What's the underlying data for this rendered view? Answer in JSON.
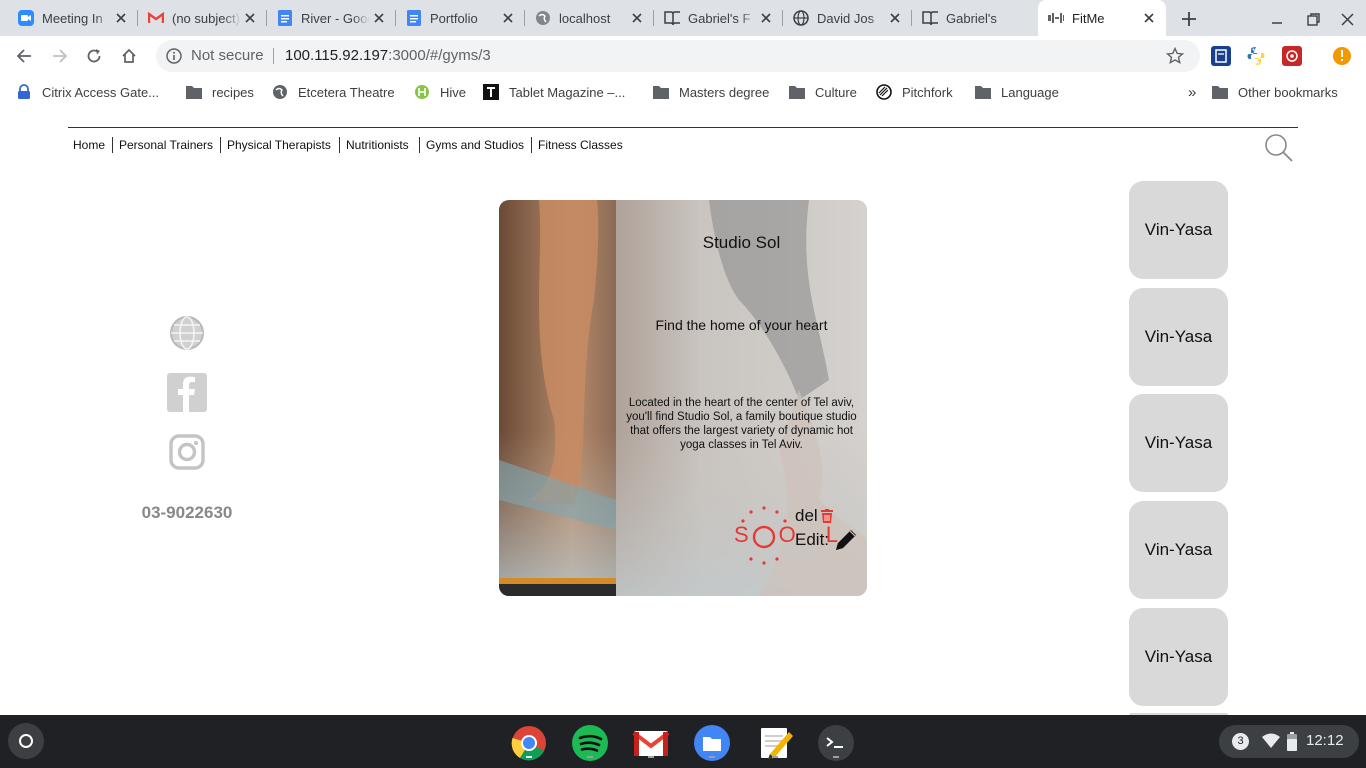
{
  "browser": {
    "tabs": [
      {
        "title": "Meeting In",
        "icon": "zoom-icon"
      },
      {
        "title": "(no subject)",
        "icon": "gmail-icon"
      },
      {
        "title": "River - Google Docs",
        "icon": "docs-icon"
      },
      {
        "title": "Portfolio",
        "icon": "docs-icon"
      },
      {
        "title": "localhost",
        "icon": "globe-icon"
      },
      {
        "title": "Gabriel's F",
        "icon": "book-icon"
      },
      {
        "title": "David Jos",
        "icon": "globe-icon"
      },
      {
        "title": "Gabriel's",
        "icon": "book-icon"
      },
      {
        "title": "FitMe",
        "icon": "fitme-icon",
        "active": true
      }
    ],
    "security_label": "Not secure",
    "url_host": "100.115.92.197",
    "url_rest": ":3000/#/gyms/3",
    "bookmarks": [
      {
        "label": "Citrix Access Gate...",
        "icon": "citrix-icon"
      },
      {
        "label": "recipes",
        "icon": "folder-icon"
      },
      {
        "label": "Etcetera Theatre",
        "icon": "globe-icon"
      },
      {
        "label": "Hive",
        "icon": "hive-icon"
      },
      {
        "label": "Tablet Magazine –...",
        "icon": "tablet-icon"
      },
      {
        "label": "Masters degree",
        "icon": "folder-icon"
      },
      {
        "label": "Culture",
        "icon": "folder-icon"
      },
      {
        "label": "Pitchfork",
        "icon": "pitchfork-icon"
      },
      {
        "label": "Language",
        "icon": "folder-icon"
      }
    ],
    "overflow": "»",
    "other_bookmarks": "Other bookmarks"
  },
  "site": {
    "nav": [
      "Home",
      "Personal Trainers",
      "Physical Therapists",
      "Nutritionists",
      "Gyms and Studios",
      "Fitness Classes"
    ],
    "phone": "03-9022630",
    "studio": {
      "name": "Studio Sol",
      "tagline": "Find the home of your heart",
      "description": "Located in the heart of the center of Tel aviv, you'll find Studio Sol, a family boutique studio that offers the largest variety of dynamic hot yoga classes in Tel Aviv.",
      "del_label": "del",
      "edit_label": "Edit:",
      "logo_text": "SOL"
    },
    "classes": [
      "Vin-Yasa",
      "Vin-Yasa",
      "Vin-Yasa",
      "Vin-Yasa",
      "Vin-Yasa"
    ]
  },
  "shelf": {
    "apps": [
      "chrome-icon",
      "spotify-icon",
      "gmail-icon",
      "files-icon",
      "text-editor-icon",
      "terminal-icon"
    ],
    "notification_count": "3",
    "time": "12:12"
  },
  "colors": {
    "accent_red": "#e53935",
    "card_overlay": "#d9d9d9",
    "shelf": "#202124"
  }
}
